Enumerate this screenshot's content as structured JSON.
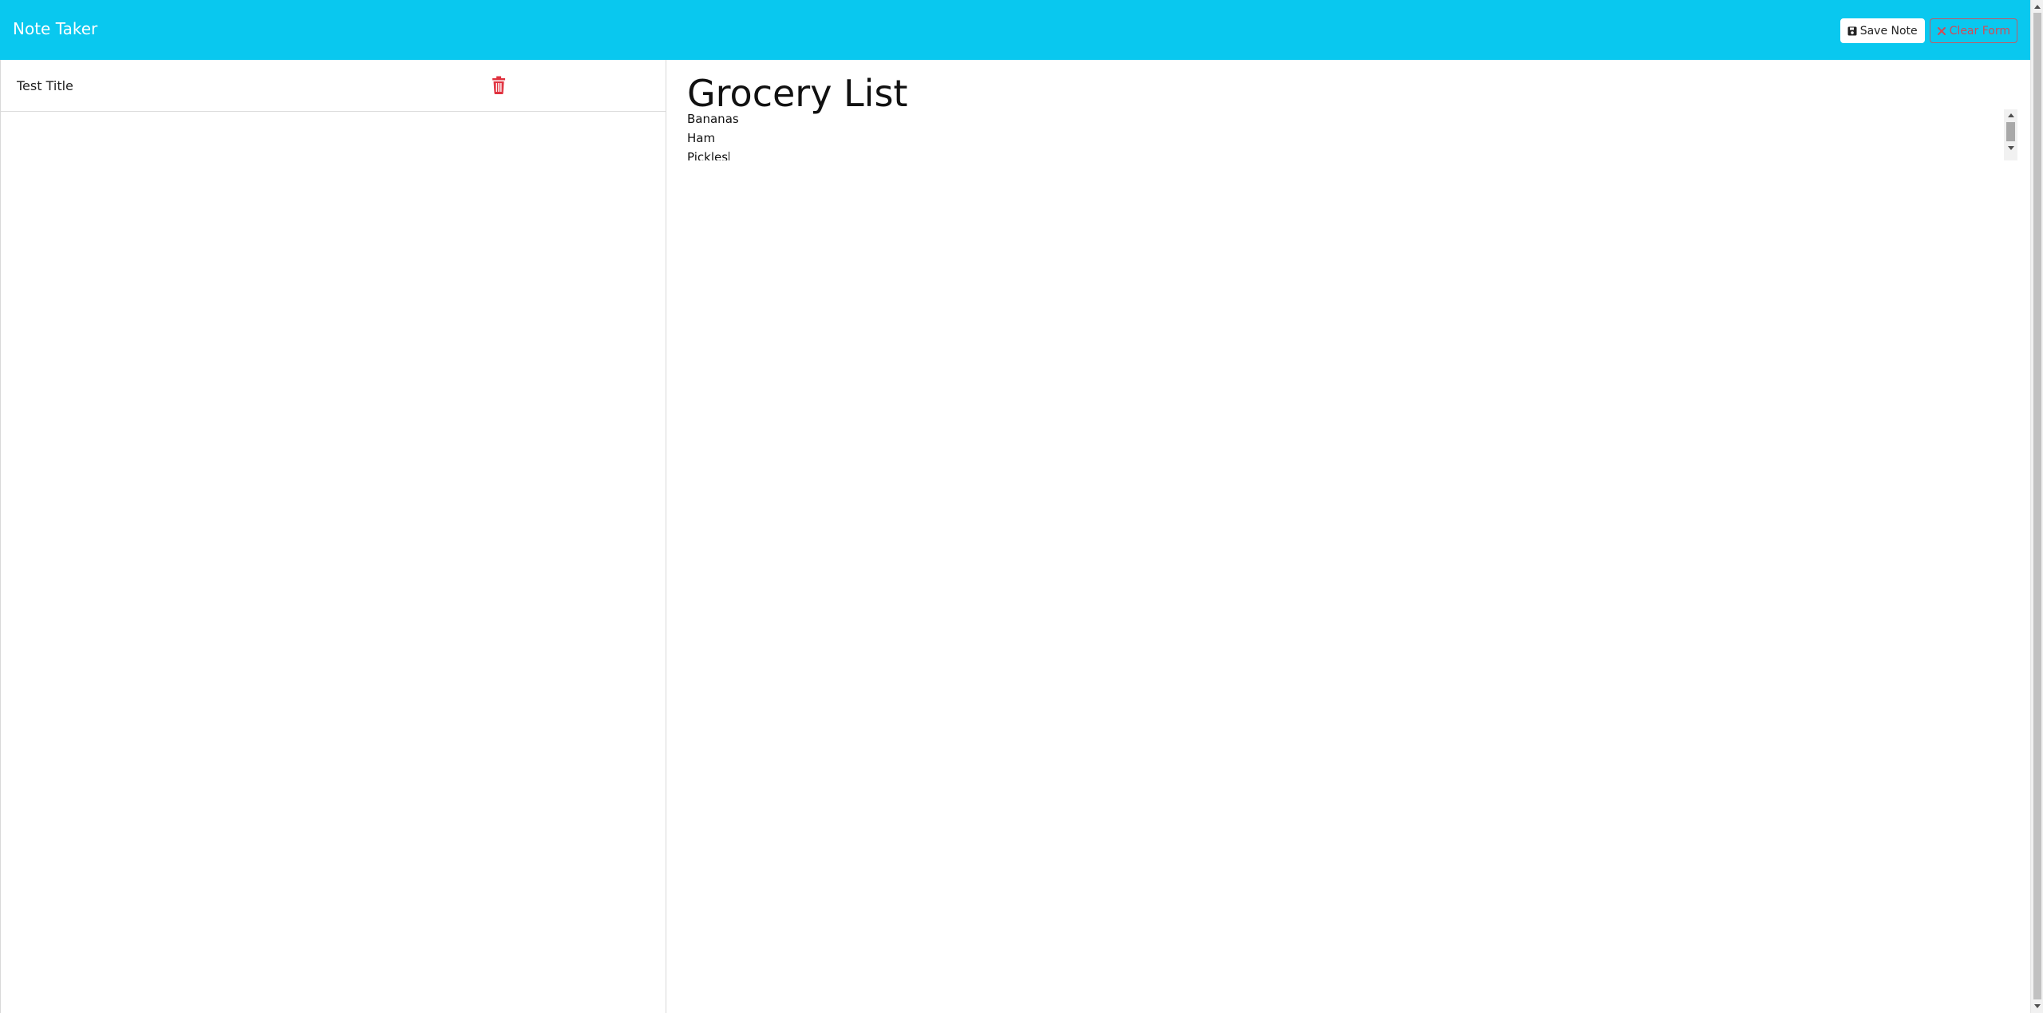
{
  "navbar": {
    "brand": "Note Taker",
    "save_label": "Save Note",
    "clear_label": "Clear Form"
  },
  "sidebar": {
    "notes": [
      {
        "title": "Test Title"
      }
    ]
  },
  "editor": {
    "title": "Grocery List",
    "lines": [
      "Bananas",
      "Ham",
      "Pickles"
    ]
  },
  "colors": {
    "navbar_bg": "#09c8ef",
    "delete_icon": "#e0323f",
    "clear_button": "#d44a56"
  },
  "icons": {
    "save": "floppy-disk-icon",
    "clear": "x-icon",
    "delete": "trash-icon"
  }
}
